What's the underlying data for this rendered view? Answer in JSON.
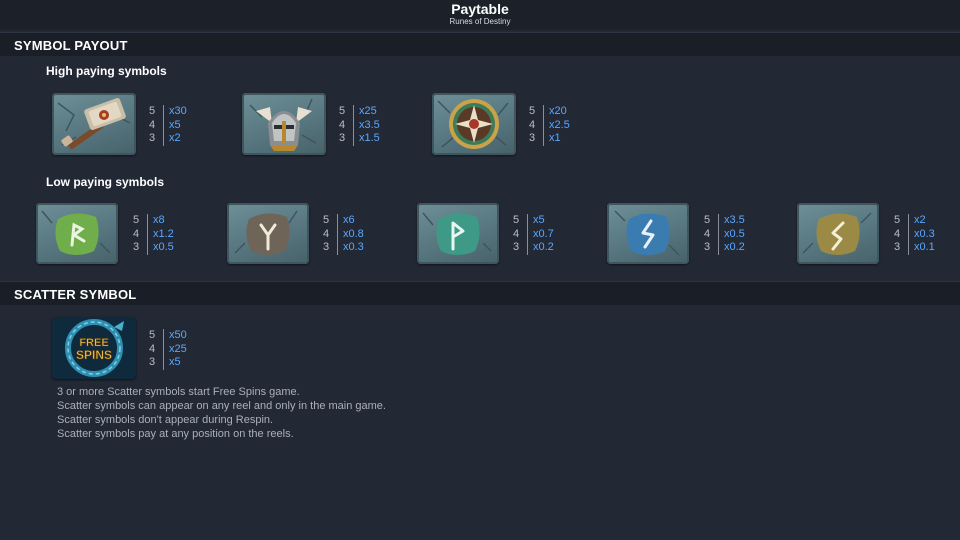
{
  "header": {
    "title": "Paytable",
    "subtitle": "Runes of Destiny"
  },
  "sections": {
    "symbol_payout": "SYMBOL PAYOUT",
    "scatter_symbol": "SCATTER SYMBOL"
  },
  "high": {
    "heading": "High paying symbols",
    "symbols": [
      {
        "name": "hammer",
        "rows": [
          {
            "n": "5",
            "m": "x30"
          },
          {
            "n": "4",
            "m": "x5"
          },
          {
            "n": "3",
            "m": "x2"
          }
        ]
      },
      {
        "name": "helmet",
        "rows": [
          {
            "n": "5",
            "m": "x25"
          },
          {
            "n": "4",
            "m": "x3.5"
          },
          {
            "n": "3",
            "m": "x1.5"
          }
        ]
      },
      {
        "name": "shield",
        "rows": [
          {
            "n": "5",
            "m": "x20"
          },
          {
            "n": "4",
            "m": "x2.5"
          },
          {
            "n": "3",
            "m": "x1"
          }
        ]
      }
    ]
  },
  "low": {
    "heading": "Low paying symbols",
    "symbols": [
      {
        "name": "green-rune",
        "color": "#6fae4a",
        "rows": [
          {
            "n": "5",
            "m": "x8"
          },
          {
            "n": "4",
            "m": "x1.2"
          },
          {
            "n": "3",
            "m": "x0.5"
          }
        ]
      },
      {
        "name": "brown-rune",
        "color": "#6e6458",
        "rows": [
          {
            "n": "5",
            "m": "x6"
          },
          {
            "n": "4",
            "m": "x0.8"
          },
          {
            "n": "3",
            "m": "x0.3"
          }
        ]
      },
      {
        "name": "teal-rune",
        "color": "#3e9a86",
        "rows": [
          {
            "n": "5",
            "m": "x5"
          },
          {
            "n": "4",
            "m": "x0.7"
          },
          {
            "n": "3",
            "m": "x0.2"
          }
        ]
      },
      {
        "name": "blue-rune",
        "color": "#3b7cb0",
        "rows": [
          {
            "n": "5",
            "m": "x3.5"
          },
          {
            "n": "4",
            "m": "x0.5"
          },
          {
            "n": "3",
            "m": "x0.2"
          }
        ]
      },
      {
        "name": "olive-rune",
        "color": "#9a8a45",
        "rows": [
          {
            "n": "5",
            "m": "x2"
          },
          {
            "n": "4",
            "m": "x0.3"
          },
          {
            "n": "3",
            "m": "x0.1"
          }
        ]
      }
    ]
  },
  "scatter": {
    "icon_text_1": "FREE",
    "icon_text_2": "SPINS",
    "rows": [
      {
        "n": "5",
        "m": "x50"
      },
      {
        "n": "4",
        "m": "x25"
      },
      {
        "n": "3",
        "m": "x5"
      }
    ],
    "notes": [
      "3 or more Scatter symbols start Free Spins game.",
      "Scatter symbols can appear on any reel and only in the main game.",
      "Scatter symbols don't appear during Respin.",
      "Scatter symbols pay at any position on the reels."
    ]
  }
}
